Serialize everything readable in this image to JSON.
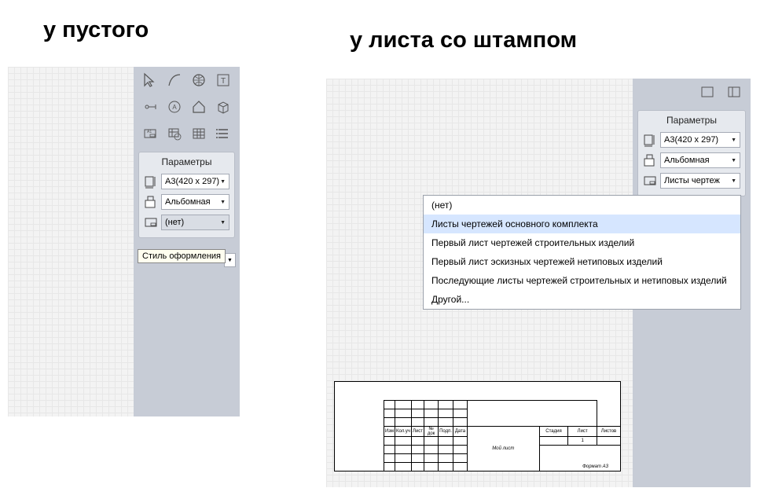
{
  "headings": {
    "left": "у пустого",
    "right": "у листа со штампом"
  },
  "left": {
    "params_title": "Параметры",
    "format": "А3(420 х 297)",
    "orientation": "Альбомная",
    "style": "(нет)",
    "tooltip": "Стиль оформления"
  },
  "right": {
    "params_title": "Параметры",
    "format": "А3(420 х 297)",
    "orientation": "Альбомная",
    "style": "Листы чертеж",
    "frame_format": "Формат  А3",
    "sheet_name": "Мой лист",
    "tb": {
      "h1": "Изм",
      "h2": "Кол.уч",
      "h3": "Лист",
      "h4": "№ док",
      "h5": "Подп.",
      "h6": "Дата",
      "s1": "Стадия",
      "s2": "Лист",
      "s3": "Листов",
      "sheet_num": "1"
    }
  },
  "dropdown": {
    "items": [
      "(нет)",
      "Листы чертежей основного комплекта",
      "Первый лист чертежей строительных изделий",
      "Первый лист эскизных чертежей нетиповых изделий",
      "Последующие листы чертежей строительных и нетиповых изделий",
      "Другой..."
    ],
    "highlighted_index": 1
  }
}
